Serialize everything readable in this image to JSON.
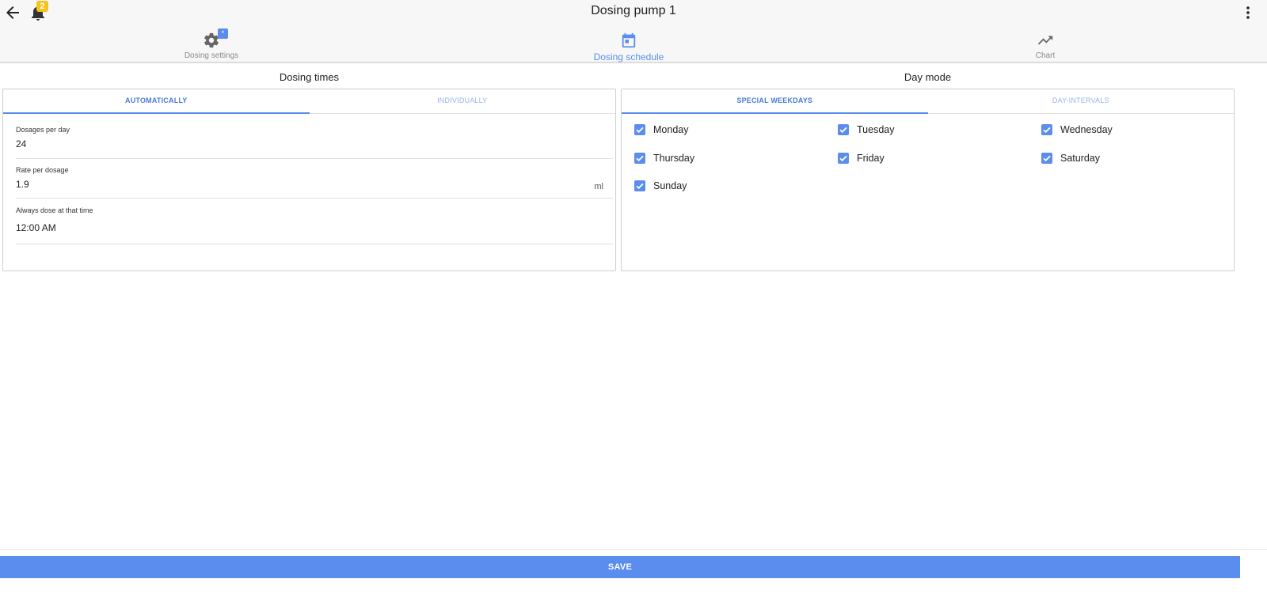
{
  "header": {
    "title": "Dosing pump 1",
    "notification_count": "2",
    "back_icon": "arrow-left-icon",
    "bell_icon": "bell-icon",
    "more_icon": "more-vertical-icon"
  },
  "nav_tabs": [
    {
      "label": "Dosing settings",
      "icon": "gear-icon",
      "badge": "*",
      "active": false
    },
    {
      "label": "Dosing schedule",
      "icon": "calendar-icon",
      "active": true
    },
    {
      "label": "Chart",
      "icon": "trending-up-icon",
      "active": false
    }
  ],
  "dosing_times": {
    "title": "Dosing times",
    "tabs": [
      {
        "label": "AUTOMATICALLY",
        "active": true
      },
      {
        "label": "INDIVIDUALLY",
        "active": false
      }
    ],
    "fields": {
      "dosages_per_day": {
        "label": "Dosages per day",
        "value": "24"
      },
      "rate_per_dosage": {
        "label": "Rate per dosage",
        "value": "1.9",
        "unit": "ml"
      },
      "always_dose_time": {
        "label": "Always dose at that time",
        "value": "12:00 AM"
      }
    }
  },
  "day_mode": {
    "title": "Day mode",
    "tabs": [
      {
        "label": "SPECIAL WEEKDAYS",
        "active": true
      },
      {
        "label": "DAY-INTERVALS",
        "active": false
      }
    ],
    "days": [
      {
        "label": "Monday",
        "checked": true
      },
      {
        "label": "Tuesday",
        "checked": true
      },
      {
        "label": "Wednesday",
        "checked": true
      },
      {
        "label": "Thursday",
        "checked": true
      },
      {
        "label": "Friday",
        "checked": true
      },
      {
        "label": "Saturday",
        "checked": true
      },
      {
        "label": "Sunday",
        "checked": true
      }
    ]
  },
  "footer": {
    "save_label": "SAVE"
  },
  "colors": {
    "accent": "#5b8def",
    "badge": "#f6c21c"
  }
}
